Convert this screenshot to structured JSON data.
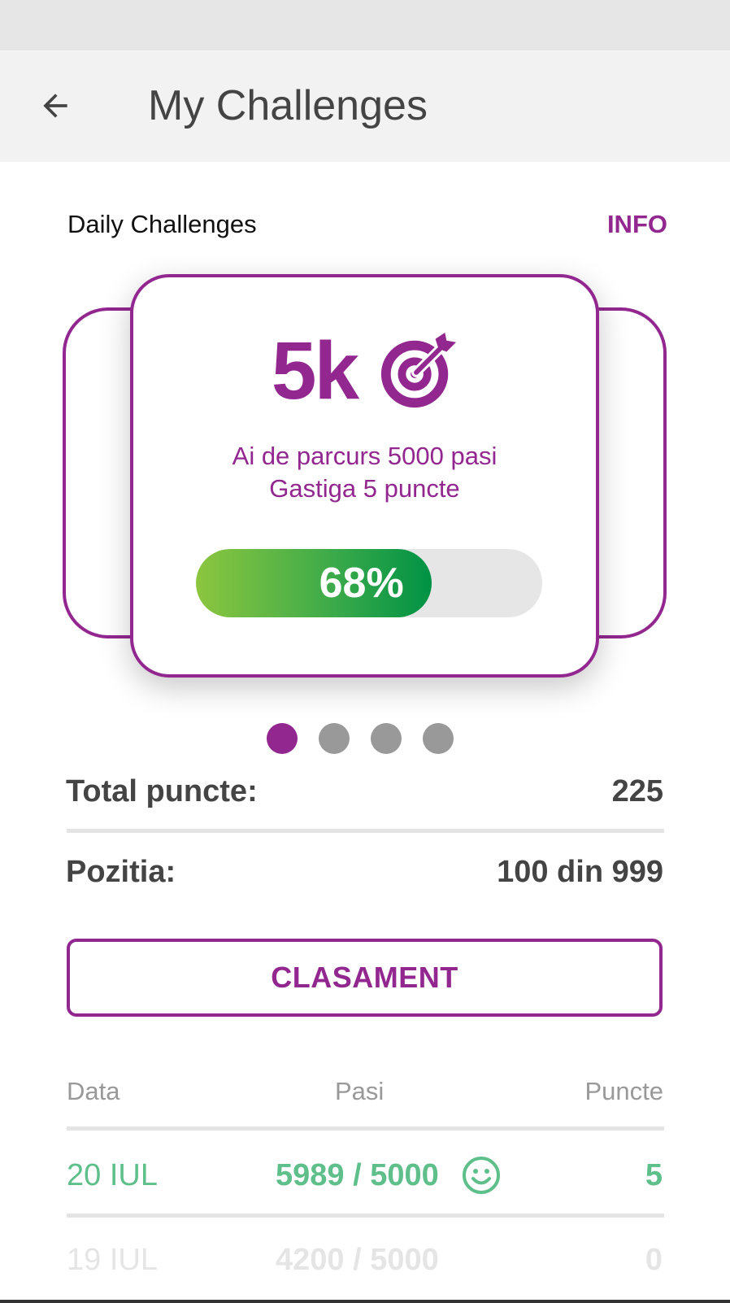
{
  "app_bar": {
    "title": "My Challenges",
    "back_icon": "arrow-left-icon"
  },
  "section": {
    "title": "Daily Challenges",
    "info_label": "INFO"
  },
  "challenge_card": {
    "goal": "5k",
    "goal_icon": "target-arrow-icon",
    "line1": "Ai de parcurs 5000 pasi",
    "line2": "Gastiga 5 puncte",
    "progress_percent": 68,
    "progress_label": "68%"
  },
  "carousel": {
    "pages": 4,
    "active_index": 0
  },
  "stats": {
    "total_label": "Total puncte:",
    "total_value": "225",
    "position_label": "Pozitia:",
    "position_value": "100 din 999"
  },
  "leaderboard_button": "CLASAMENT",
  "history": {
    "headers": [
      "Data",
      "Pasi",
      "Puncte"
    ],
    "rows": [
      {
        "date": "20 IUL",
        "steps": "5989 / 5000",
        "points": "5",
        "icon": "smiley-icon"
      },
      {
        "date": "19 IUL",
        "steps": "4200 / 5000",
        "points": "0"
      }
    ]
  },
  "colors": {
    "accent": "#92278f",
    "progress_start": "#8cc63f",
    "progress_end": "#009245",
    "success_text": "#5fbf8b",
    "dot_inactive": "#999999"
  }
}
